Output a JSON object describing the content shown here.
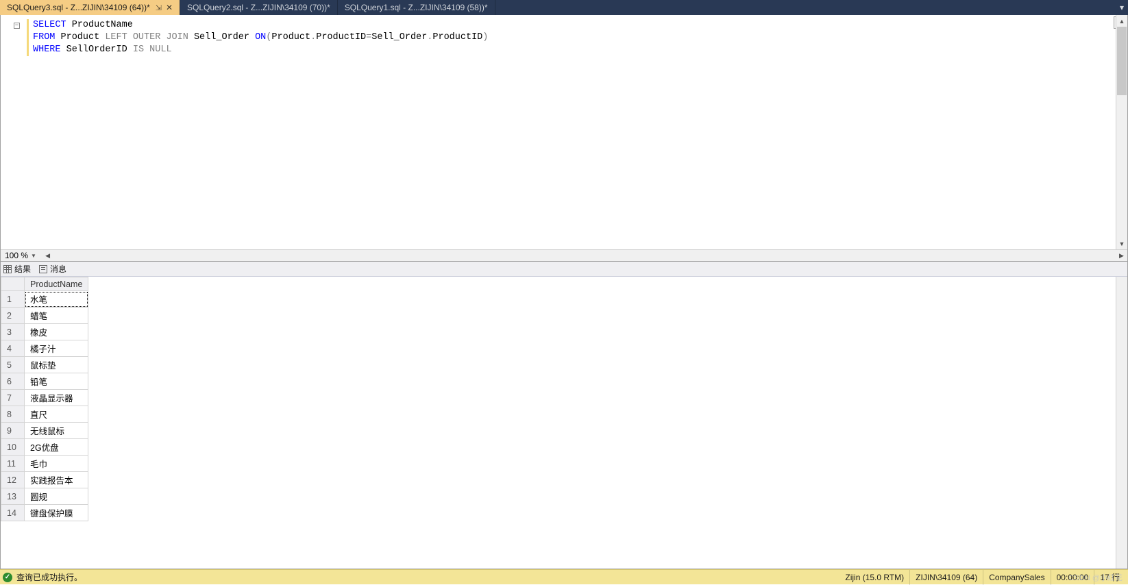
{
  "tabs": [
    {
      "label": "SQLQuery3.sql - Z...ZIJIN\\34109 (64))*",
      "active": true,
      "pinned": true,
      "closeable": true
    },
    {
      "label": "SQLQuery2.sql - Z...ZIJIN\\34109 (70))*",
      "active": false
    },
    {
      "label": "SQLQuery1.sql - Z...ZIJIN\\34109 (58))*",
      "active": false
    }
  ],
  "sql": {
    "line1": {
      "kw1": "SELECT",
      "rest": " ProductName"
    },
    "line2": {
      "kw1": "FROM",
      "t1": " Product ",
      "gray1": "LEFT OUTER JOIN",
      "t2": " Sell_Order ",
      "kw2": "ON",
      "gray2": "(",
      "t3": "Product",
      "gray3": ".",
      "t4": "ProductID",
      "gray4": "=",
      "t5": "Sell_Order",
      "gray5": ".",
      "t6": "ProductID",
      "gray6": ")"
    },
    "line3": {
      "kw1": "WHERE",
      "t1": " SellOrderID ",
      "gray1": "IS NULL"
    }
  },
  "zoom": "100 %",
  "results": {
    "tabs": {
      "results": "结果",
      "messages": "消息"
    },
    "column_header": "ProductName",
    "rows": [
      "水笔",
      "蜡笔",
      "橡皮",
      "橘子汁",
      "鼠标垫",
      "铅笔",
      "液晶显示器",
      "直尺",
      "无线鼠标",
      "2G优盘",
      "毛巾",
      "实践报告本",
      "圆规",
      "键盘保护膜"
    ]
  },
  "status": {
    "message": "查询已成功执行。",
    "items": [
      "Zijin (15.0 RTM)",
      "ZIJIN\\34109 (64)",
      "CompanySales",
      "00:00:00",
      "17 行"
    ]
  },
  "watermark": "CSDN @小红花"
}
